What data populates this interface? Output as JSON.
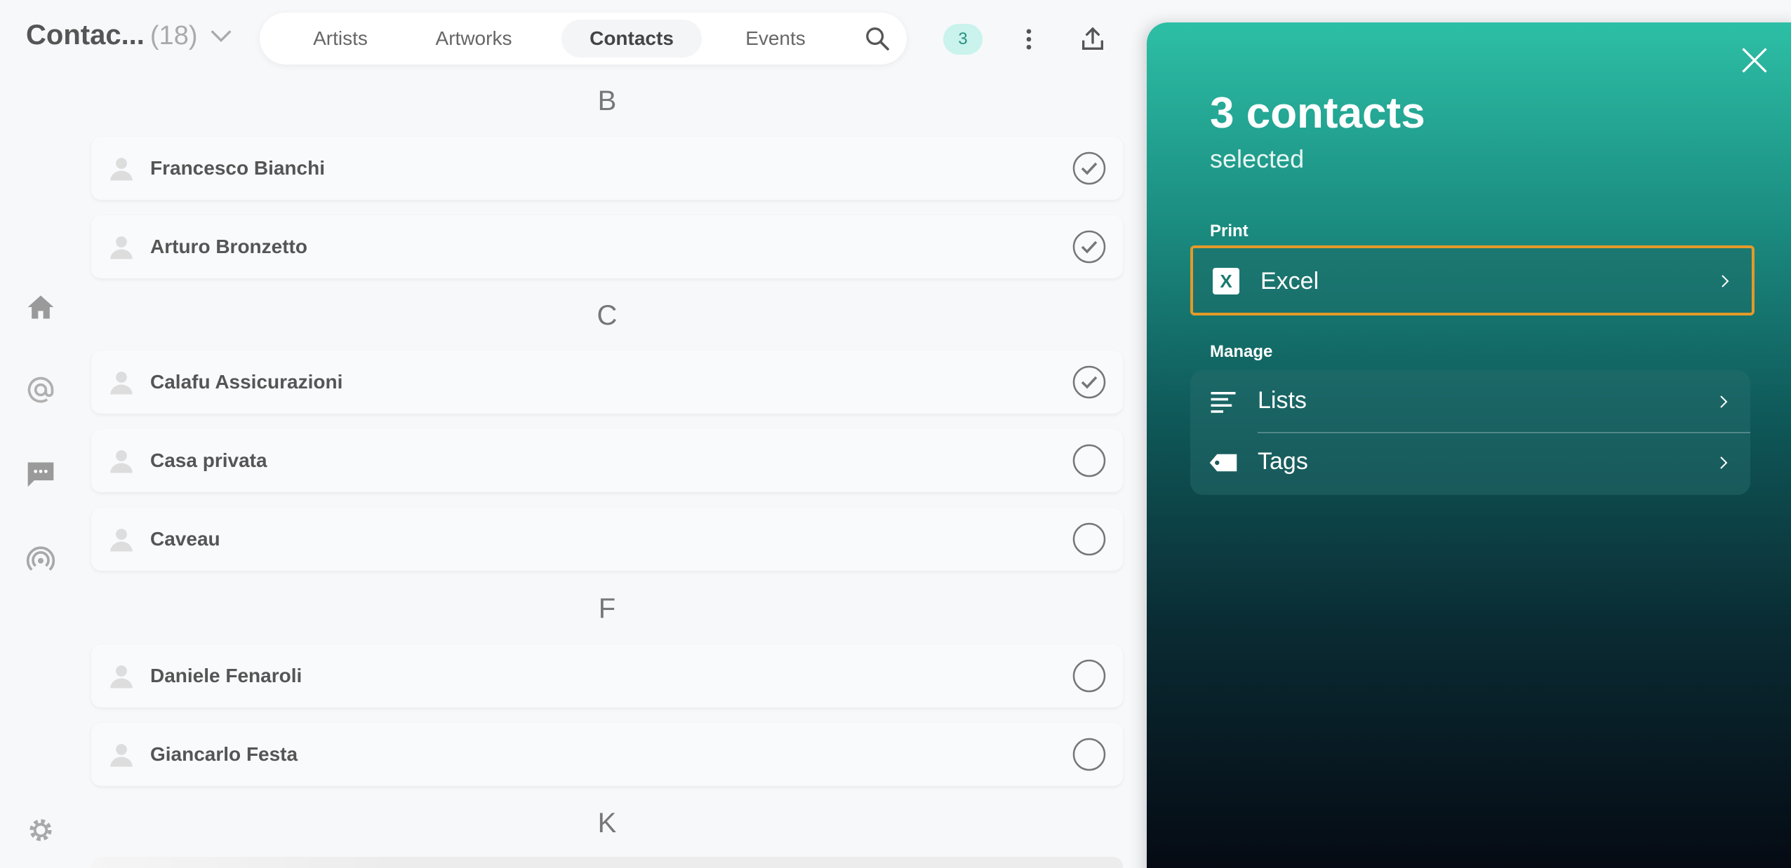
{
  "header": {
    "title": "Contac...",
    "count": "(18)",
    "tabs": [
      {
        "label": "Artists",
        "active": false
      },
      {
        "label": "Artworks",
        "active": false
      },
      {
        "label": "Contacts",
        "active": true
      },
      {
        "label": "Events",
        "active": false
      }
    ],
    "selection_badge": "3",
    "icons": [
      "chevron-down-icon",
      "search-icon",
      "more-vertical-icon",
      "export-icon"
    ]
  },
  "rail": {
    "icons": [
      "home-icon",
      "at-icon",
      "chat-icon",
      "broadcast-icon",
      "settings-icon"
    ]
  },
  "list": {
    "sections": [
      {
        "letter": "B",
        "contacts": [
          {
            "name": "Francesco Bianchi",
            "selected": true
          },
          {
            "name": "Arturo Bronzetto",
            "selected": true
          }
        ]
      },
      {
        "letter": "C",
        "contacts": [
          {
            "name": "Calafu Assicurazioni",
            "selected": true
          },
          {
            "name": "Casa privata",
            "selected": false
          },
          {
            "name": "Caveau",
            "selected": false
          }
        ]
      },
      {
        "letter": "F",
        "contacts": [
          {
            "name": "Daniele Fenaroli",
            "selected": false
          },
          {
            "name": "Giancarlo Festa",
            "selected": false
          }
        ]
      },
      {
        "letter": "K",
        "contacts": []
      }
    ]
  },
  "panel": {
    "title": "3 contacts",
    "subtitle": "selected",
    "print_label": "Print",
    "excel_icon_letter": "X",
    "excel_label": "Excel",
    "manage_label": "Manage",
    "lists_label": "Lists",
    "tags_label": "Tags",
    "colors": {
      "gradient_top": "#2dbfa6",
      "gradient_bottom": "#050811",
      "highlight_border": "#e29a2a"
    }
  }
}
